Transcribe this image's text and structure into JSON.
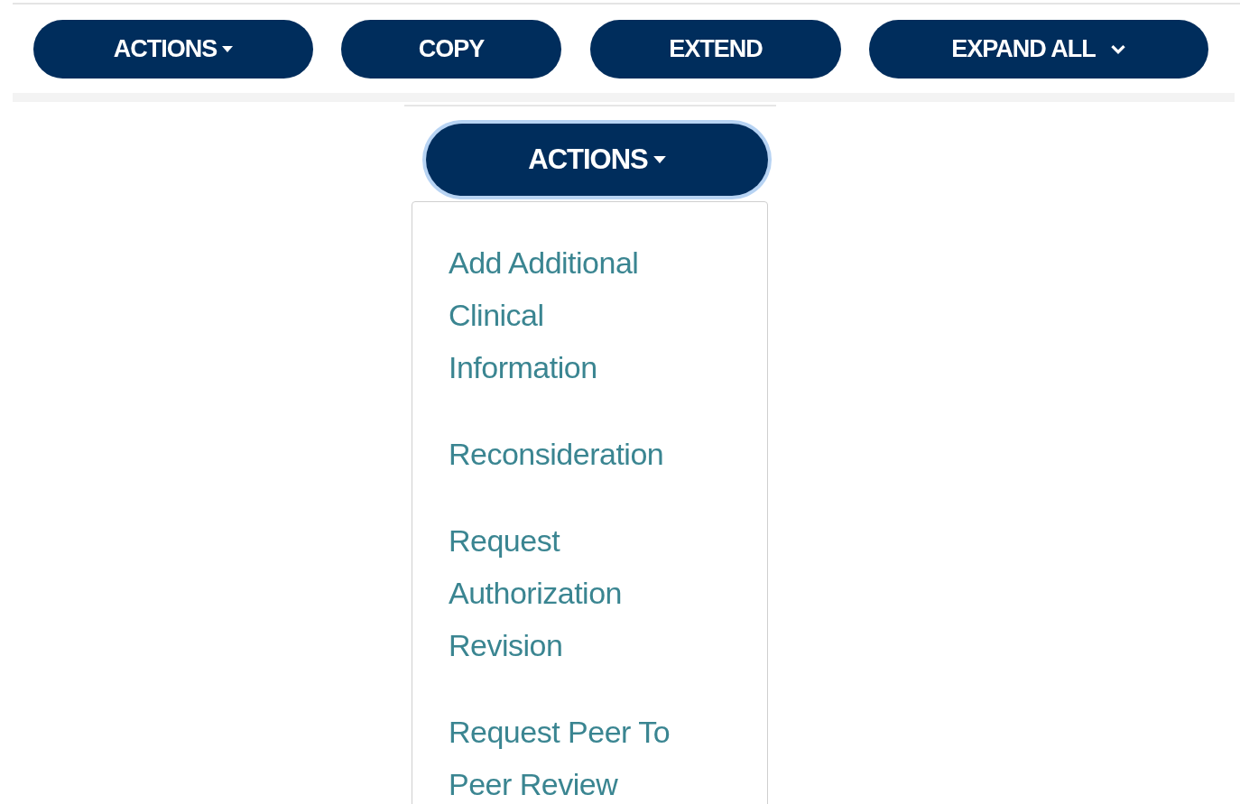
{
  "toolbar": [
    {
      "label": "ACTIONS",
      "kind": "dropdown"
    },
    {
      "label": "COPY",
      "kind": "plain"
    },
    {
      "label": "EXTEND",
      "kind": "plain"
    },
    {
      "label": "EXPAND ALL",
      "kind": "expand"
    }
  ],
  "actions_menu": {
    "button": {
      "label": "ACTIONS",
      "kind": "dropdown",
      "focused": true
    },
    "expanded": true,
    "items": [
      {
        "label": "Add Additional Clinical Information"
      },
      {
        "label": "Reconsideration"
      },
      {
        "label": "Request Authorization Revision"
      },
      {
        "label": "Request Peer To Peer Review"
      }
    ]
  }
}
